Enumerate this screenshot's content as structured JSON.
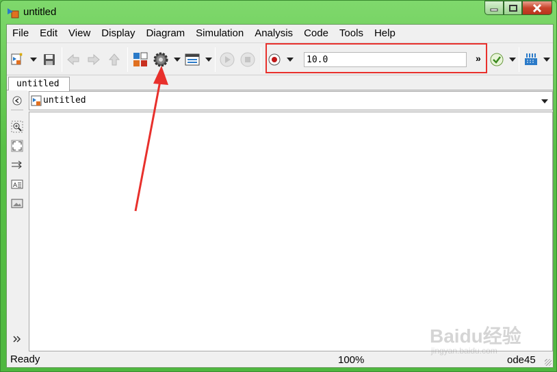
{
  "window": {
    "title": "untitled"
  },
  "menu": [
    "File",
    "Edit",
    "View",
    "Display",
    "Diagram",
    "Simulation",
    "Analysis",
    "Code",
    "Tools",
    "Help"
  ],
  "toolbar": {
    "icons": [
      "new-model-icon",
      "save-icon",
      "back-icon",
      "forward-icon",
      "up-icon",
      "library-browser-icon",
      "model-config-icon",
      "model-explorer-icon",
      "run-icon",
      "stop-icon",
      "record-icon",
      "more-icon",
      "check-icon",
      "build-icon"
    ],
    "stop_time": "10.0",
    "more_label": "»"
  },
  "tab": {
    "label": "untitled"
  },
  "address": {
    "path": "untitled"
  },
  "palette": [
    "back-icon",
    "zoom-in-icon",
    "fit-view-icon",
    "arrow-icon",
    "annotation-icon",
    "image-icon",
    "expand-icon"
  ],
  "status": {
    "ready": "Ready",
    "zoom": "100%",
    "solver": "ode45"
  },
  "watermark": {
    "main": "Baidu经验",
    "sub": "jingyan.baidu.com"
  },
  "colors": {
    "annotation": "#e8302c",
    "frame": "#58c046"
  }
}
